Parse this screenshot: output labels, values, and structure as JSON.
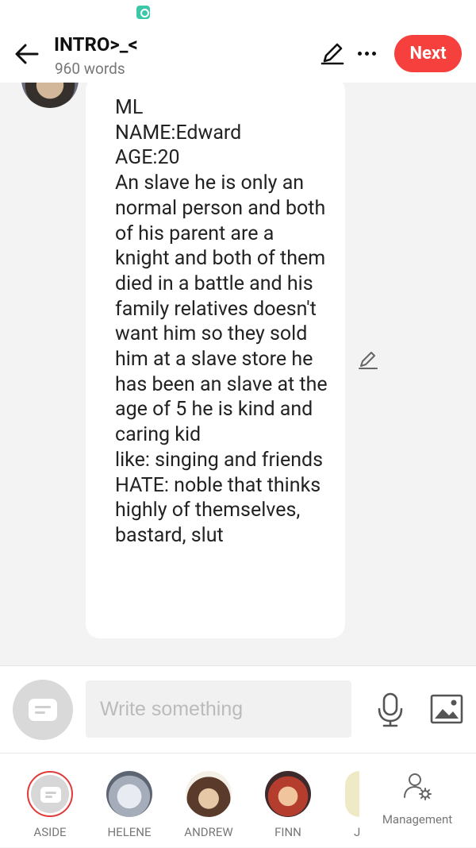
{
  "header": {
    "title": "INTRO>_<",
    "word_count": "960 words",
    "next_label": "Next",
    "accent_color": "#f5403d"
  },
  "message": {
    "speaker_icon": "avatar",
    "text": "ML\nNAME:Edward\nAGE:20\nAn slave he is only an normal person and both of his parent are a knight and both of them died in a battle and his family relatives doesn't want him so they sold him at a slave store he has been an slave at the age of 5 he is kind and caring kid\nlike: singing and friends\nHATE: noble that thinks highly of themselves, bastard, slut"
  },
  "composer": {
    "placeholder": "Write something"
  },
  "characters": [
    {
      "label": "ASIDE"
    },
    {
      "label": "HELENE"
    },
    {
      "label": "ANDREW"
    },
    {
      "label": "FINN"
    }
  ],
  "partial_label": "J",
  "management_label": "Management"
}
